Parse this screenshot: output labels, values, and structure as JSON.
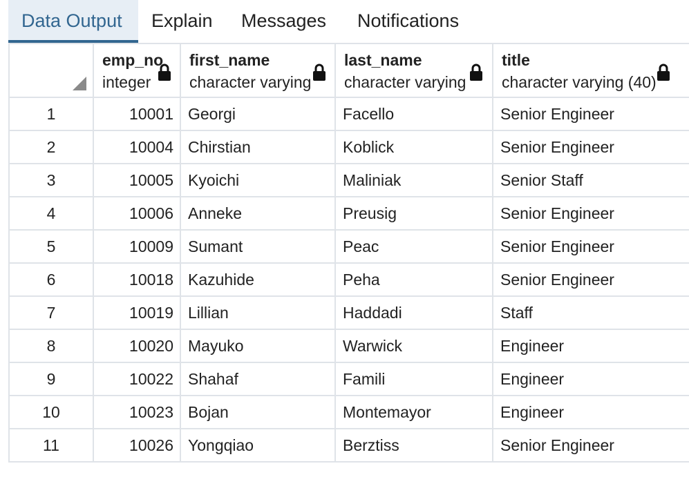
{
  "tabs": [
    {
      "label": "Data Output",
      "active": true
    },
    {
      "label": "Explain",
      "active": false
    },
    {
      "label": "Messages",
      "active": false
    },
    {
      "label": "Notifications",
      "active": false
    }
  ],
  "columns": [
    {
      "name": "emp_no",
      "type": "integer",
      "locked": true
    },
    {
      "name": "first_name",
      "type": "character varying",
      "locked": true
    },
    {
      "name": "last_name",
      "type": "character varying",
      "locked": true
    },
    {
      "name": "title",
      "type": "character varying (40)",
      "locked": true
    }
  ],
  "rows": [
    {
      "n": "1",
      "emp_no": "10001",
      "first_name": "Georgi",
      "last_name": "Facello",
      "title": "Senior Engineer"
    },
    {
      "n": "2",
      "emp_no": "10004",
      "first_name": "Chirstian",
      "last_name": "Koblick",
      "title": "Senior Engineer"
    },
    {
      "n": "3",
      "emp_no": "10005",
      "first_name": "Kyoichi",
      "last_name": "Maliniak",
      "title": "Senior Staff"
    },
    {
      "n": "4",
      "emp_no": "10006",
      "first_name": "Anneke",
      "last_name": "Preusig",
      "title": "Senior Engineer"
    },
    {
      "n": "5",
      "emp_no": "10009",
      "first_name": "Sumant",
      "last_name": "Peac",
      "title": "Senior Engineer"
    },
    {
      "n": "6",
      "emp_no": "10018",
      "first_name": "Kazuhide",
      "last_name": "Peha",
      "title": "Senior Engineer"
    },
    {
      "n": "7",
      "emp_no": "10019",
      "first_name": "Lillian",
      "last_name": "Haddadi",
      "title": "Staff"
    },
    {
      "n": "8",
      "emp_no": "10020",
      "first_name": "Mayuko",
      "last_name": "Warwick",
      "title": "Engineer"
    },
    {
      "n": "9",
      "emp_no": "10022",
      "first_name": "Shahaf",
      "last_name": "Famili",
      "title": "Engineer"
    },
    {
      "n": "10",
      "emp_no": "10023",
      "first_name": "Bojan",
      "last_name": "Montemayor",
      "title": "Engineer"
    },
    {
      "n": "11",
      "emp_no": "10026",
      "first_name": "Yongqiao",
      "last_name": "Berztiss",
      "title": "Senior Engineer"
    }
  ],
  "colors": {
    "accent": "#326690",
    "tab_active_bg": "#e7eef5",
    "grid_line": "#dfe3e8"
  },
  "icons": {
    "column_lock": "lock-icon",
    "select_all": "select-all-triangle-icon"
  }
}
